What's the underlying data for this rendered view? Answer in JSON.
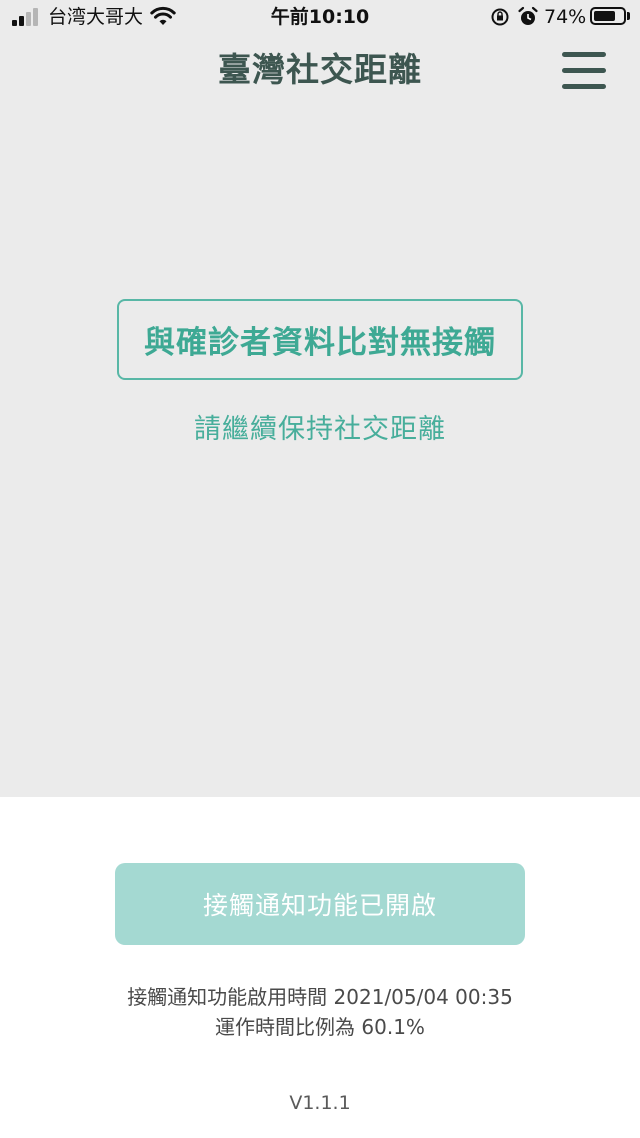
{
  "status_bar": {
    "carrier": "台湾大哥大",
    "time": "午前10:10",
    "battery_text": "74%",
    "battery_level": 0.74,
    "signal_bars_active": 2,
    "signal_bars_total": 4
  },
  "header": {
    "title": "臺灣社交距離",
    "menu_icon": "hamburger-menu-icon"
  },
  "result": {
    "headline": "與確診者資料比對無接觸",
    "message": "請繼續保持社交距離"
  },
  "notification": {
    "button_label": "接觸通知功能已開啟",
    "enabled_line": "接觸通知功能啟用時間 2021/05/04 00:35",
    "ratio_line": "運作時間比例為 60.1%"
  },
  "footer": {
    "version": "V1.1.1"
  },
  "colors": {
    "accent": "#3ea994",
    "button_bg": "#a4d9d2",
    "title": "#3d5650",
    "top_bg": "#ebebeb"
  }
}
